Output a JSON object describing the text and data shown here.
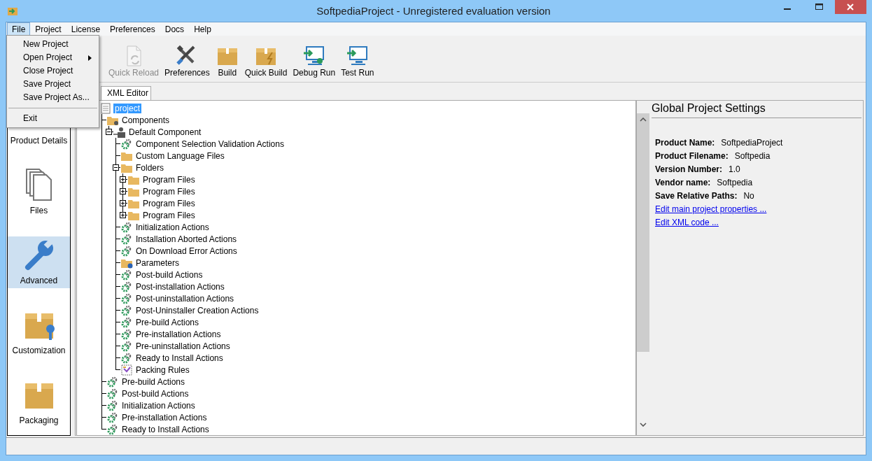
{
  "window": {
    "title": "SoftpediaProject - Unregistered evaluation version"
  },
  "menu_bar": [
    {
      "label": "File",
      "selected": true
    },
    {
      "label": "Project",
      "selected": false
    },
    {
      "label": "License",
      "selected": false
    },
    {
      "label": "Preferences",
      "selected": false
    },
    {
      "label": "Docs",
      "selected": false
    },
    {
      "label": "Help",
      "selected": false
    }
  ],
  "file_menu": [
    {
      "label": "New Project",
      "submenu": false
    },
    {
      "label": "Open Project",
      "submenu": true
    },
    {
      "label": "Close Project",
      "submenu": false
    },
    {
      "label": "Save Project",
      "submenu": false
    },
    {
      "label": "Save Project As...",
      "submenu": false
    },
    {
      "kind": "separator"
    },
    {
      "label": "Exit",
      "submenu": false
    }
  ],
  "toolbar": [
    {
      "label": "Quick Reload",
      "kind": "reload",
      "disabled": true
    },
    {
      "label": "Preferences",
      "kind": "tools",
      "disabled": false
    },
    {
      "label": "Build",
      "kind": "box",
      "disabled": false
    },
    {
      "label": "Quick Build",
      "kind": "box-bolt",
      "disabled": false
    },
    {
      "label": "Debug Run",
      "kind": "monitor-bug",
      "disabled": false
    },
    {
      "label": "Test Run",
      "kind": "monitor",
      "disabled": false
    }
  ],
  "tabs": [
    {
      "label": "XML Editor",
      "selected": true
    }
  ],
  "sidebar": [
    {
      "label": "Product Details",
      "kind": "none",
      "selected": false
    },
    {
      "label": "Files",
      "kind": "files",
      "selected": false
    },
    {
      "label": "Advanced",
      "kind": "wrench",
      "selected": true
    },
    {
      "label": "Customization",
      "kind": "box-wrench",
      "selected": false
    },
    {
      "label": "Packaging",
      "kind": "box",
      "selected": false
    }
  ],
  "tree": [
    {
      "label": "project",
      "kind": "document",
      "selected": true,
      "children": [
        {
          "label": "Components",
          "kind": "folder-gear",
          "selected": false,
          "children": [
            {
              "label": "Default Component",
              "kind": "component",
              "selected": false,
              "expanded": true,
              "children": [
                {
                  "label": "Component Selection Validation Actions",
                  "kind": "gear",
                  "selected": false
                },
                {
                  "label": "Custom Language Files",
                  "kind": "folder",
                  "selected": false
                },
                {
                  "label": "Folders",
                  "kind": "folder",
                  "selected": false,
                  "expanded": true,
                  "children": [
                    {
                      "label": "Program Files",
                      "kind": "folder",
                      "selected": false,
                      "expanded": false
                    },
                    {
                      "label": "Program Files",
                      "kind": "folder",
                      "selected": false,
                      "expanded": false
                    },
                    {
                      "label": "Program Files",
                      "kind": "folder",
                      "selected": false,
                      "expanded": false
                    },
                    {
                      "label": "Program Files",
                      "kind": "folder",
                      "selected": false,
                      "expanded": false
                    }
                  ]
                },
                {
                  "label": "Initialization Actions",
                  "kind": "gear",
                  "selected": false
                },
                {
                  "label": "Installation Aborted Actions",
                  "kind": "gear",
                  "selected": false
                },
                {
                  "label": "On Download Error Actions",
                  "kind": "gear",
                  "selected": false
                },
                {
                  "label": "Parameters",
                  "kind": "folder-help",
                  "selected": false
                },
                {
                  "label": "Post-build Actions",
                  "kind": "gear",
                  "selected": false
                },
                {
                  "label": "Post-installation Actions",
                  "kind": "gear",
                  "selected": false
                },
                {
                  "label": "Post-uninstallation Actions",
                  "kind": "gear",
                  "selected": false
                },
                {
                  "label": "Post-Uninstaller Creation Actions",
                  "kind": "gear",
                  "selected": false
                },
                {
                  "label": "Pre-build Actions",
                  "kind": "gear",
                  "selected": false
                },
                {
                  "label": "Pre-installation Actions",
                  "kind": "gear",
                  "selected": false
                },
                {
                  "label": "Pre-uninstallation Actions",
                  "kind": "gear",
                  "selected": false
                },
                {
                  "label": "Ready to Install Actions",
                  "kind": "gear",
                  "selected": false
                },
                {
                  "label": "Packing Rules",
                  "kind": "packing",
                  "selected": false
                }
              ]
            }
          ]
        },
        {
          "label": "Pre-build Actions",
          "kind": "gear",
          "selected": false
        },
        {
          "label": "Post-build Actions",
          "kind": "gear",
          "selected": false
        },
        {
          "label": "Initialization Actions",
          "kind": "gear",
          "selected": false
        },
        {
          "label": "Pre-installation Actions",
          "kind": "gear",
          "selected": false
        },
        {
          "label": "Ready to Install Actions",
          "kind": "gear",
          "selected": false
        }
      ]
    }
  ],
  "settings": {
    "title": "Global Project Settings",
    "properties": [
      {
        "label": "Product Name:",
        "value": "SoftpediaProject"
      },
      {
        "label": "Product Filename:",
        "value": "Softpedia"
      },
      {
        "label": "Version Number:",
        "value": "1.0"
      },
      {
        "label": "Vendor name:",
        "value": "Softpedia"
      },
      {
        "label": "Save Relative Paths:",
        "value": "No"
      }
    ],
    "links": [
      "Edit main project properties ...",
      "Edit XML code ..."
    ]
  }
}
